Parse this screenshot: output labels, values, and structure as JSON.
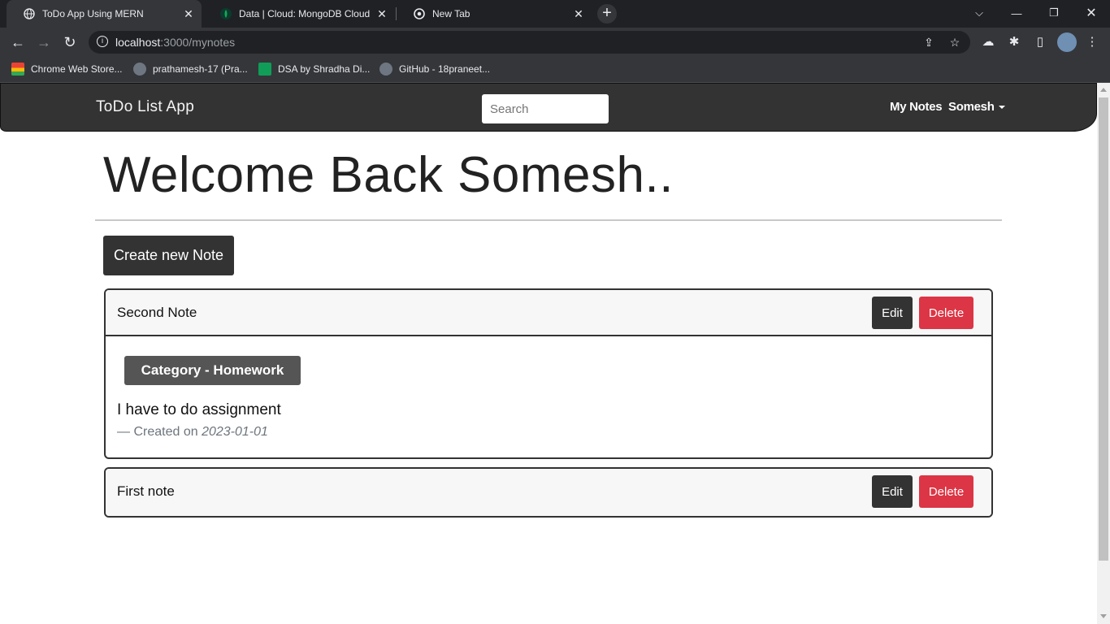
{
  "browser": {
    "tabs": [
      {
        "title": "ToDo App Using MERN",
        "active": true,
        "icon": "globe-icon"
      },
      {
        "title": "Data | Cloud: MongoDB Cloud",
        "active": false,
        "icon": "mongodb-leaf-icon"
      },
      {
        "title": "New Tab",
        "active": false,
        "icon": "chrome-icon"
      }
    ],
    "url_host": "localhost",
    "url_path": ":3000/mynotes",
    "bookmarks": [
      {
        "label": "Chrome Web Store...",
        "icon": "web-store-icon"
      },
      {
        "label": "prathamesh-17 (Pra...",
        "icon": "github-icon"
      },
      {
        "label": "DSA by Shradha Di...",
        "icon": "sheets-icon"
      },
      {
        "label": "GitHub - 18praneet...",
        "icon": "github-icon"
      }
    ]
  },
  "navbar": {
    "brand": "ToDo List App",
    "search_placeholder": "Search",
    "my_notes": "My Notes",
    "user": "Somesh"
  },
  "main": {
    "welcome": "Welcome Back Somesh..",
    "create_button": "Create new Note",
    "notes": [
      {
        "title": "Second Note",
        "expanded": true,
        "category": "Category - Homework",
        "content": "I have to do assignment",
        "created_prefix": "— Created on",
        "created_date": "2023-01-01",
        "edit": "Edit",
        "delete": "Delete"
      },
      {
        "title": "First note",
        "expanded": false,
        "edit": "Edit",
        "delete": "Delete"
      }
    ]
  },
  "colors": {
    "navbar_bg": "#333333",
    "delete_red": "#dc3545",
    "badge_bg": "#555555"
  }
}
